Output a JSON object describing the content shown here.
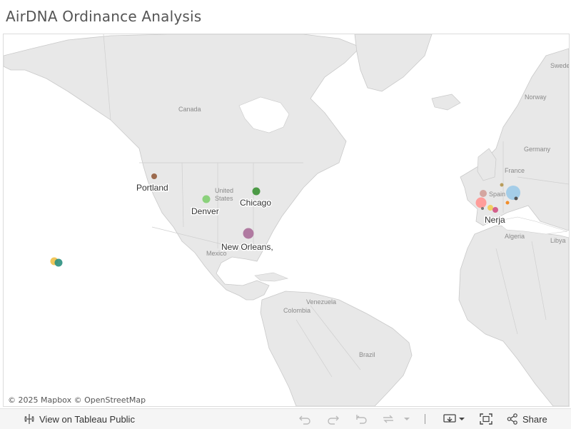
{
  "title": "AirDNA Ordinance Analysis",
  "map": {
    "attribution": "© 2025 Mapbox  © OpenStreetMap",
    "cities": [
      {
        "name": "portland",
        "label": "Portland"
      },
      {
        "name": "denver",
        "label": "Denver"
      },
      {
        "name": "chicago",
        "label": "Chicago"
      },
      {
        "name": "new-orleans",
        "label": "New Orleans,"
      },
      {
        "name": "nerja",
        "label": "Nerja"
      }
    ],
    "countries": {
      "canada": "Canada",
      "united": "United",
      "states": "States",
      "mexico": "Mexico",
      "venezuela": "Venezuela",
      "colombia": "Colombia",
      "brazil": "Brazil",
      "sweden": "Swede",
      "norway": "Norway",
      "germany": "Germany",
      "france": "France",
      "spain": "Spain",
      "algeria": "Algeria",
      "libya": "Libya"
    },
    "colors": {
      "land": "#e8e8e8",
      "water": "#ffffff",
      "border": "#c8c8c8"
    }
  },
  "toolbar": {
    "view_label": "View on Tableau Public",
    "share_label": "Share"
  }
}
